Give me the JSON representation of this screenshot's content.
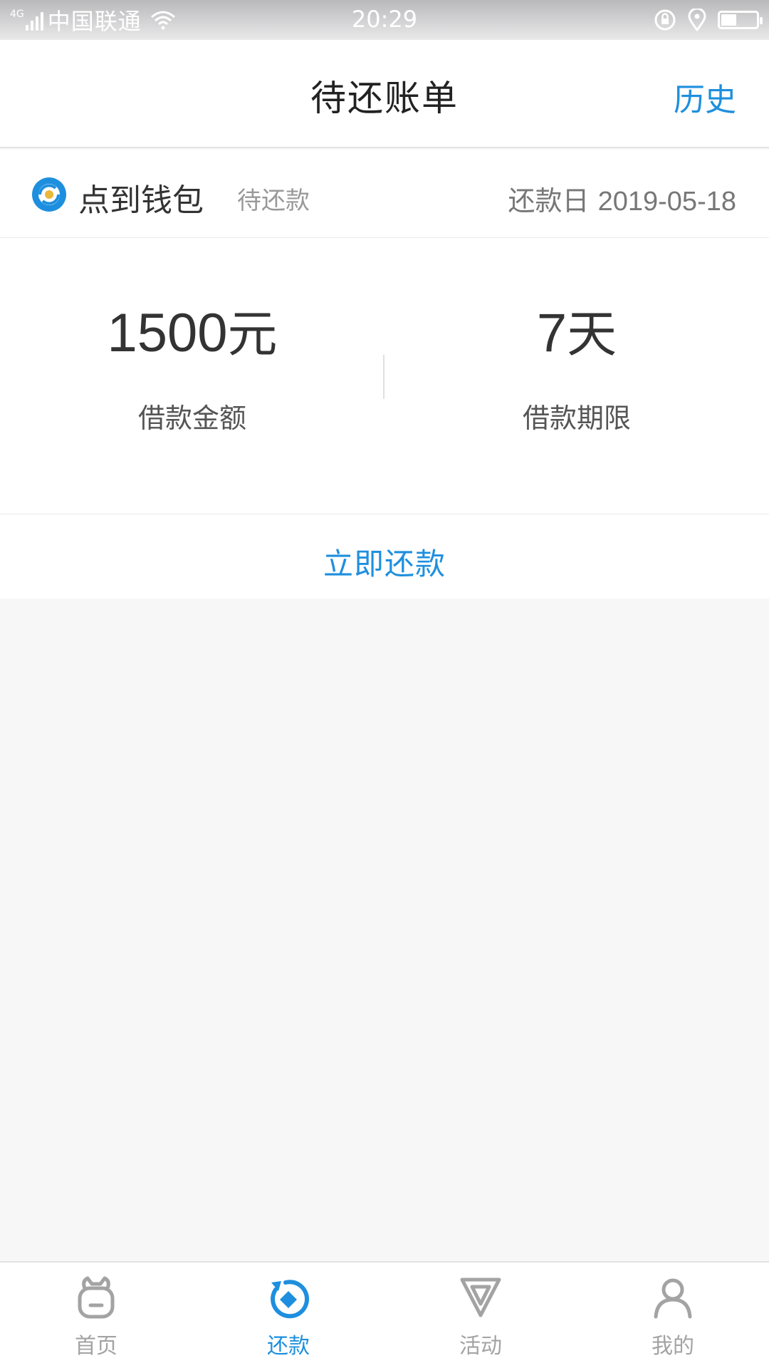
{
  "status_bar": {
    "network": "4G",
    "carrier": "中国联通",
    "time": "20:29",
    "icons": [
      "signal-icon",
      "wifi-icon",
      "rotation-lock-icon",
      "location-icon",
      "battery-icon"
    ],
    "battery_level": 0.4
  },
  "header": {
    "title": "待还账单",
    "history_label": "历史"
  },
  "loan": {
    "brand_name": "点到钱包",
    "status": "待还款",
    "due_label": "还款日",
    "due_date": "2019-05-18",
    "amount_value": "1500",
    "amount_unit": "元",
    "amount_label": "借款金额",
    "term_value": "7",
    "term_unit": "天",
    "term_label": "借款期限",
    "pay_button": "立即还款"
  },
  "tabs": [
    {
      "label": "首页",
      "icon": "home-bag-icon",
      "active": false
    },
    {
      "label": "还款",
      "icon": "repay-icon",
      "active": true
    },
    {
      "label": "活动",
      "icon": "activity-icon",
      "active": false
    },
    {
      "label": "我的",
      "icon": "profile-icon",
      "active": false
    }
  ],
  "colors": {
    "accent": "#1e8fde",
    "inactive_tab": "#a3a3a3",
    "background": "#f7f7f8"
  }
}
